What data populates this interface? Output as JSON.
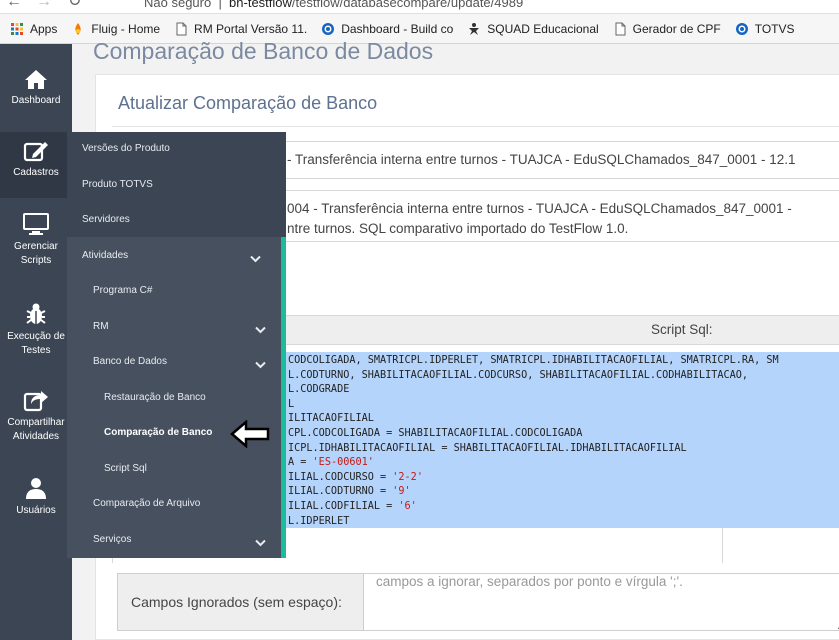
{
  "browser": {
    "security_label": "Não seguro",
    "url_host": "bh-testflow",
    "url_path": "/testflow/databasecompare/update/4989",
    "bookmarks": [
      {
        "label": "Apps",
        "icon": "apps-grid-icon"
      },
      {
        "label": "Fluig - Home",
        "icon": "fluig-icon"
      },
      {
        "label": "RM Portal Versão 11.",
        "icon": "page-icon"
      },
      {
        "label": "Dashboard - Build co",
        "icon": "globe-icon"
      },
      {
        "label": "SQUAD Educacional",
        "icon": "squad-icon"
      },
      {
        "label": "Gerador de CPF",
        "icon": "page-icon"
      },
      {
        "label": "TOTVS",
        "icon": "globe-icon"
      }
    ]
  },
  "sidebar": {
    "items": [
      {
        "label": "Dashboard",
        "icon": "home-icon"
      },
      {
        "label": "Cadastros",
        "icon": "edit-icon"
      },
      {
        "label_line1": "Gerenciar",
        "label_line2": "Scripts",
        "icon": "monitor-icon"
      },
      {
        "label_line1": "Execução de",
        "label_line2": "Testes",
        "icon": "bug-icon"
      },
      {
        "label_line1": "Compartilhar",
        "label_line2": "Atividades",
        "icon": "share-icon"
      },
      {
        "label": "Usuários",
        "icon": "user-icon"
      }
    ]
  },
  "flyout": {
    "items": [
      "Versões do Produto",
      "Produto TOTVS",
      "Servidores",
      "Atividades",
      "Programa C#",
      "RM",
      "Banco de Dados",
      "Restauração de Banco",
      "Comparação de Banco",
      "Script Sql",
      "Comparação de Arquivo",
      "Serviços"
    ],
    "active": "Comparação de Banco"
  },
  "page": {
    "title": "Comparação de Banco de Dados",
    "panel_title": "Atualizar Comparação de Banco",
    "activity_line": "- Transferência interna entre turnos - TUAJCA - EduSQLChamados_847_0001 - 12.1",
    "description_line1": "004 - Transferência interna entre turnos - TUAJCA - EduSQLChamados_847_0001 -",
    "description_line2": "ntre turnos. SQL comparativo importado do TestFlow 1.0.",
    "sql_header": "Script Sql:",
    "sql_lines": [
      {
        "code": "CODCOLIGADA, SMATRICPL.IDPERLET, SMATRICPL.IDHABILITACAOFILIAL, SMATRICPL.RA, SM",
        "str": "",
        "tail": ""
      },
      {
        "code": "L.CODTURNO, SHABILITACAOFILIAL.CODCURSO, SHABILITACAOFILIAL.CODHABILITACAO,",
        "str": "",
        "tail": ""
      },
      {
        "code": "L.CODGRADE",
        "str": "",
        "tail": ""
      },
      {
        "code": "L",
        "str": "",
        "tail": ""
      },
      {
        "code": "ILITACAOFILIAL",
        "str": "",
        "tail": ""
      },
      {
        "code": "CPL.CODCOLIGADA = SHABILITACAOFILIAL.CODCOLIGADA",
        "str": "",
        "tail": ""
      },
      {
        "code": "ICPL.IDHABILITACAOFILIAL = SHABILITACAOFILIAL.IDHABILITACAOFILIAL",
        "str": "",
        "tail": ""
      },
      {
        "code": "A = ",
        "str": "'ES-00601'",
        "tail": ""
      },
      {
        "code": "ILIAL.CODCURSO = ",
        "str": "'2-2'",
        "tail": ""
      },
      {
        "code": "ILIAL.CODTURNO = ",
        "str": "'9'",
        "tail": ""
      },
      {
        "code": "ILIAL.CODFILIAL = ",
        "str": "'6'",
        "tail": ""
      },
      {
        "code": "L.IDPERLET",
        "str": "",
        "tail": ""
      }
    ],
    "ignored_fields_label": "Campos Ignorados (sem espaço):",
    "ignored_fields_placeholder": "campos a ignorar, separados por ponto e vírgula ';'."
  },
  "colors": {
    "sidebar_bg": "#3b4553",
    "accent": "#1abc9c",
    "selection": "#b5d4fb",
    "title": "#7b8aa0"
  }
}
